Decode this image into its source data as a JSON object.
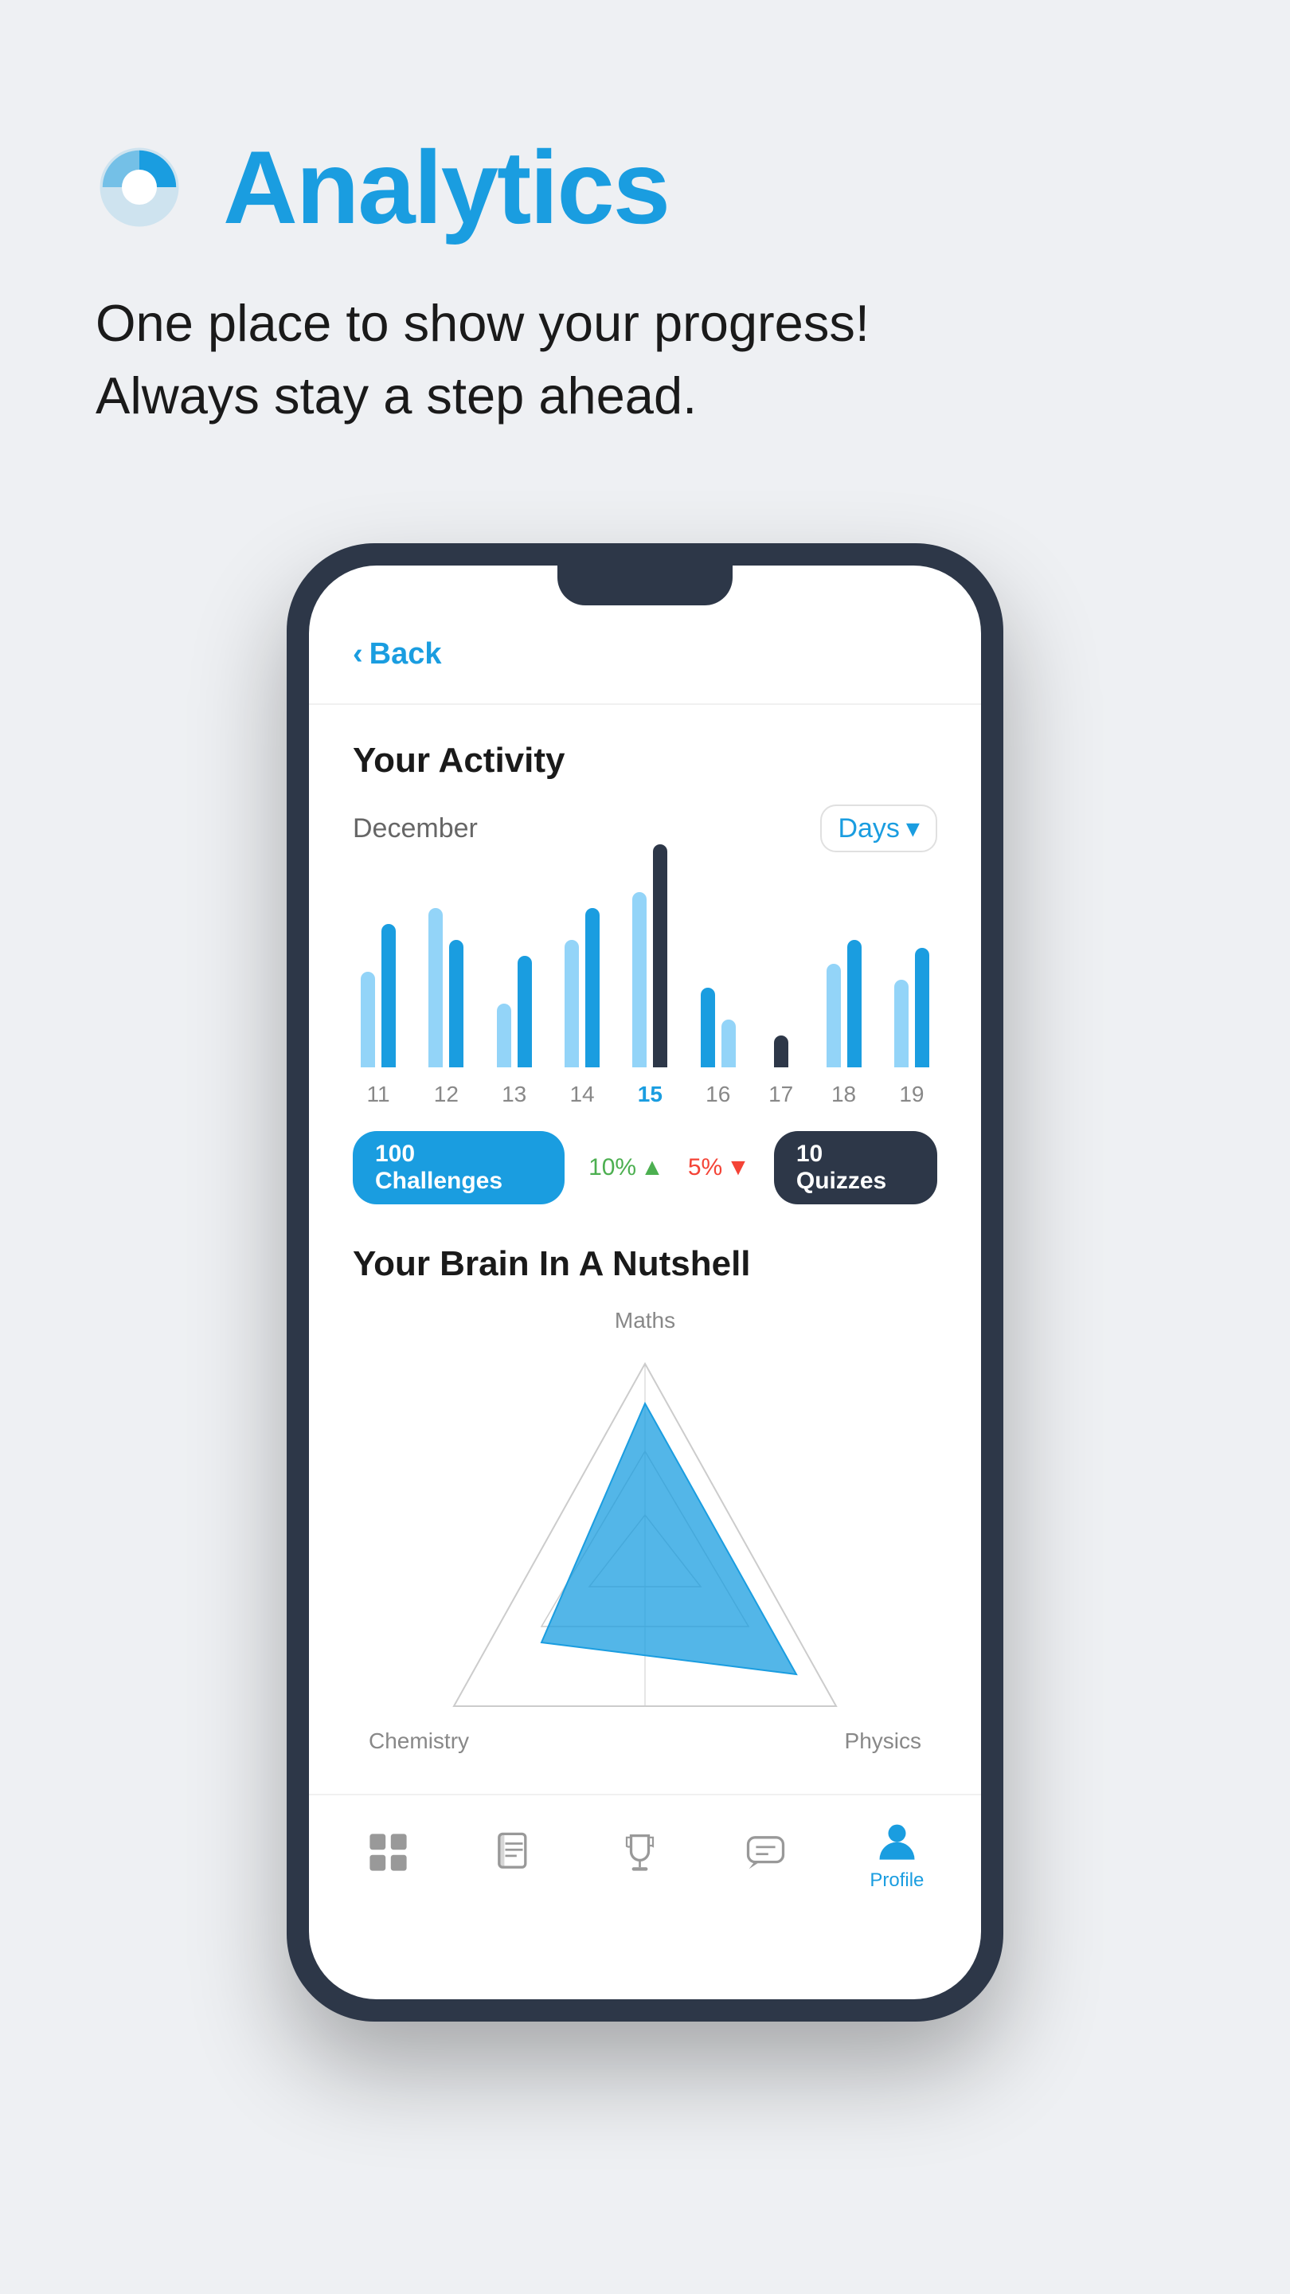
{
  "header": {
    "title": "Analytics",
    "subtitle_line1": "One place to show your progress!",
    "subtitle_line2": "Always stay a step ahead.",
    "icon_color": "#1a9de0"
  },
  "phone": {
    "back_button": "Back",
    "screen": {
      "activity_section": {
        "title": "Your Activity",
        "month": "December",
        "period_selector": "Days",
        "bars": [
          {
            "label": "11",
            "heights": [
              120,
              180
            ],
            "active": false
          },
          {
            "label": "12",
            "heights": [
              200,
              160
            ],
            "active": false
          },
          {
            "label": "13",
            "heights": [
              80,
              140
            ],
            "active": false
          },
          {
            "label": "14",
            "heights": [
              160,
              200
            ],
            "active": false
          },
          {
            "label": "15",
            "heights": [
              220,
              280
            ],
            "active": true
          },
          {
            "label": "16",
            "heights": [
              100,
              60
            ],
            "active": false
          },
          {
            "label": "17",
            "heights": [
              40,
              0
            ],
            "active": false
          },
          {
            "label": "18",
            "heights": [
              130,
              160
            ],
            "active": false
          },
          {
            "label": "19",
            "heights": [
              110,
              150
            ],
            "active": false
          }
        ],
        "stats": {
          "challenges": "100 Challenges",
          "percent_up": "10%",
          "percent_down": "5%",
          "quizzes": "10 Quizzes"
        }
      },
      "brain_section": {
        "title": "Your Brain In A Nutshell",
        "labels": {
          "top": "Maths",
          "left": "Chemistry",
          "right": "Physics"
        }
      },
      "bottom_nav": [
        {
          "label": "",
          "icon": "grid-icon",
          "active": false
        },
        {
          "label": "",
          "icon": "book-icon",
          "active": false
        },
        {
          "label": "",
          "icon": "trophy-icon",
          "active": false
        },
        {
          "label": "",
          "icon": "chat-icon",
          "active": false
        },
        {
          "label": "Profile",
          "icon": "profile-icon",
          "active": true
        }
      ]
    }
  }
}
